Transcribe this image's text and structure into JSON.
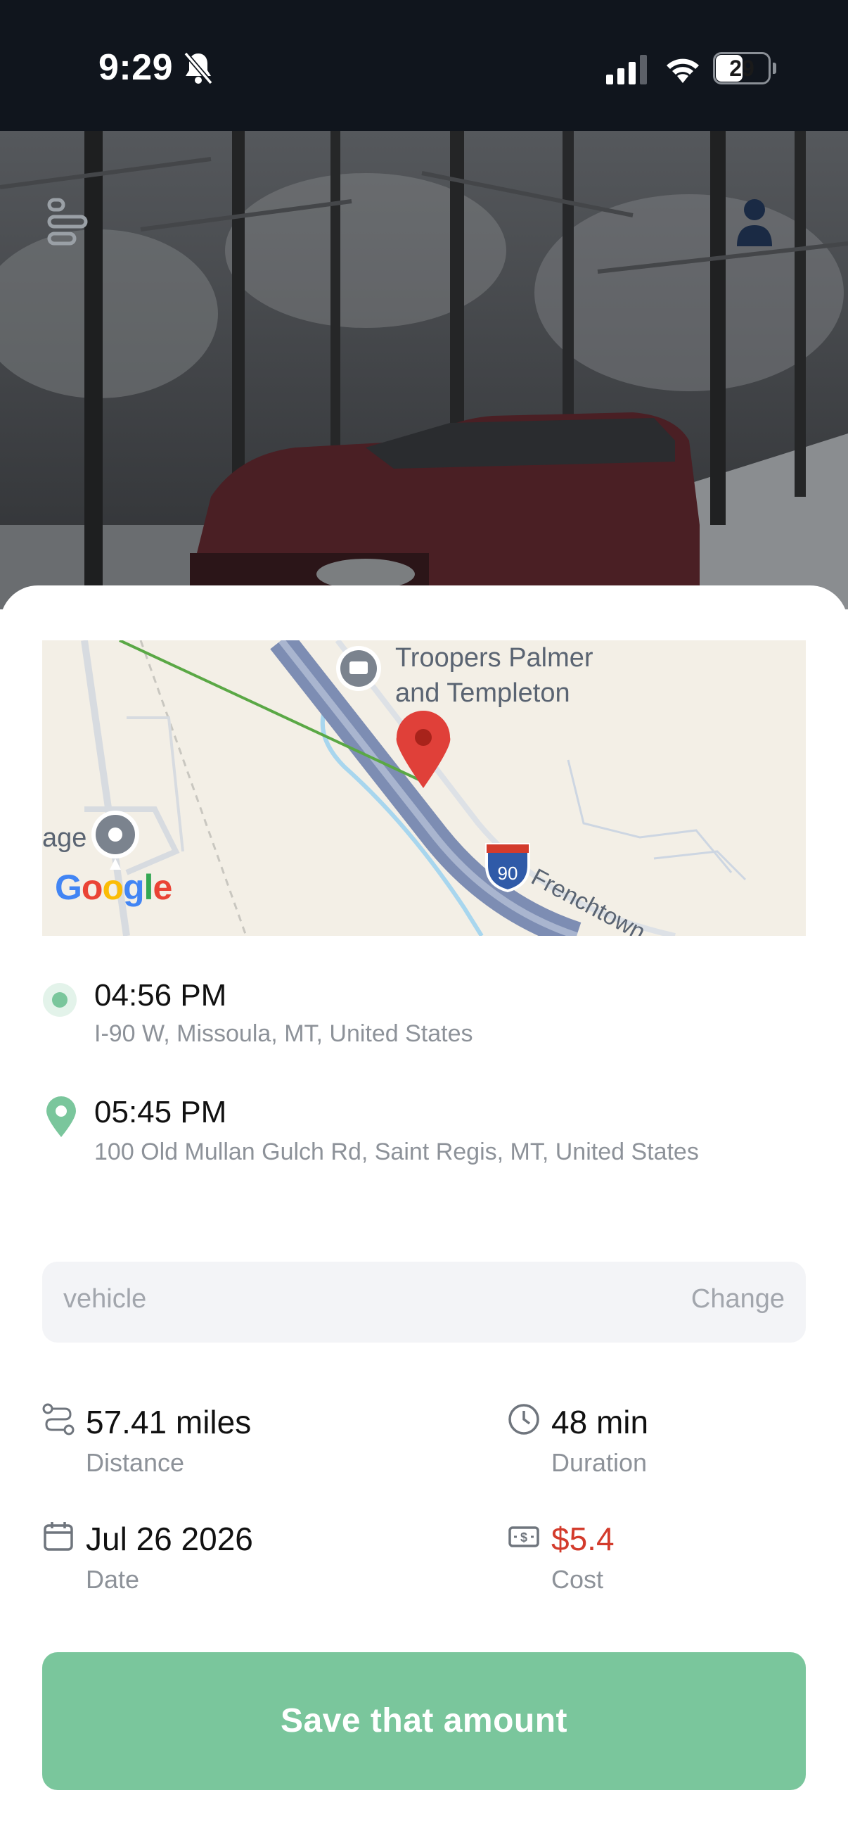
{
  "status_bar": {
    "time": "9:29",
    "battery_level": "29",
    "signal_bars": 3
  },
  "header": {
    "menu_icon": "menu-lines-icon",
    "profile_icon": "user-icon"
  },
  "map": {
    "poi_label": "Troopers Palmer and Templeton",
    "left_label": "age",
    "road_label": "Frenchtown",
    "highway_shield": "90",
    "attribution": "Google",
    "route_color": "#5aa845",
    "marker_color": "#e04039"
  },
  "trip": {
    "start": {
      "time": "04:56 PM",
      "address": "I-90 W, Missoula, MT, United States"
    },
    "end": {
      "time": "05:45 PM",
      "address": "100 Old Mullan Gulch Rd, Saint Regis, MT, United States"
    }
  },
  "vehicle": {
    "placeholder": "vehicle",
    "change_label": "Change"
  },
  "stats": {
    "distance": {
      "value": "57.41 miles",
      "label": "Distance",
      "icon": "route-icon"
    },
    "duration": {
      "value": "48 min",
      "label": "Duration",
      "icon": "clock-icon"
    },
    "date": {
      "value": "Jul 26 2026",
      "label": "Date",
      "icon": "calendar-icon"
    },
    "cost": {
      "value": "$5.4",
      "label": "Cost",
      "icon": "money-icon",
      "color": "#d33b2c"
    }
  },
  "actions": {
    "save_label": "Save that amount",
    "save_color": "#7ac69c"
  },
  "colors": {
    "accent_green": "#7ac69c",
    "status_bar_bg": "#10151d"
  }
}
